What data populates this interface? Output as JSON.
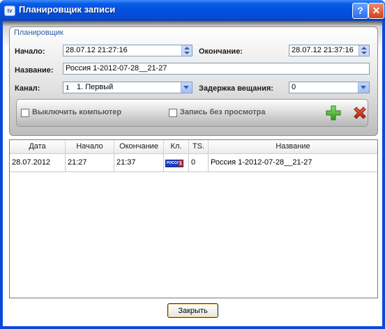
{
  "window": {
    "title": "Планировщик записи",
    "help": "?",
    "close": "✕"
  },
  "scheduler": {
    "group_title": "Планировщик",
    "start_label": "Начало:",
    "start_value": "28.07.12 21:27:16",
    "end_label": "Окончание:",
    "end_value": "28.07.12 21:37:16",
    "name_label": "Название:",
    "name_value": "Россия 1-2012-07-28__21-27",
    "channel_label": "Канал:",
    "channel_value": "1. Первый",
    "channel_icon_glyph": "1",
    "delay_label": "Задержка вещания:",
    "delay_value": "0",
    "shutdown_label": "Выключить компьютер",
    "record_no_view_label": "Запись без просмотра"
  },
  "table": {
    "columns": [
      "Дата",
      "Начало",
      "Окончание",
      "Кл.",
      "TS.",
      "Название"
    ],
    "rows": [
      {
        "date": "28.07.2012",
        "start": "21:27",
        "end": "21:37",
        "channel_logo_text": "РОССИЯ",
        "channel_logo_num": "1",
        "ts": "0",
        "name": "Россия 1-2012-07-28__21-27"
      }
    ]
  },
  "footer": {
    "close_label": "Закрыть"
  },
  "colors": {
    "titlebar": "#0050de",
    "group_title": "#2a5aa8",
    "add": "#3aa52a",
    "delete": "#c82a1a"
  }
}
